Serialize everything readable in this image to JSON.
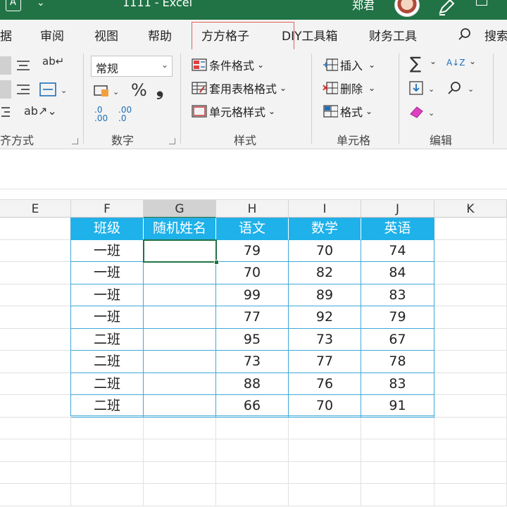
{
  "window": {
    "title_partial": "1111  -  Excel",
    "user_name_partial": "郑君"
  },
  "tabs": [
    {
      "label": "据",
      "id": "data"
    },
    {
      "label": "审阅",
      "id": "review"
    },
    {
      "label": "视图",
      "id": "view"
    },
    {
      "label": "帮助",
      "id": "help"
    },
    {
      "label": "方方格子",
      "id": "fangfang"
    },
    {
      "label": "DIY工具箱",
      "id": "diy"
    },
    {
      "label": "财务工具",
      "id": "finance"
    },
    {
      "label": "搜索",
      "id": "search"
    }
  ],
  "ribbon": {
    "alignment": {
      "label": "齐方式"
    },
    "number": {
      "label": "数字",
      "format_value": "常规",
      "percent_glyph": "%",
      "comma_glyph": "❟",
      "inc_decimal": ".0 .00",
      "dec_decimal": ".00 .0"
    },
    "styles": {
      "label": "样式",
      "conditional_format": "条件格式",
      "format_as_table": "套用表格格式",
      "cell_styles": "单元格样式"
    },
    "cells": {
      "label": "单元格",
      "insert": "插入",
      "delete": "删除",
      "format": "格式"
    },
    "editing": {
      "label": "编辑",
      "sum_glyph": "∑",
      "sort_glyph": "A↓Z"
    }
  },
  "columns": [
    "E",
    "F",
    "G",
    "H",
    "I",
    "J",
    "K"
  ],
  "table": {
    "headers": [
      "班级",
      "随机姓名",
      "语文",
      "数学",
      "英语"
    ],
    "rows": [
      [
        "一班",
        "",
        "79",
        "70",
        "74"
      ],
      [
        "一班",
        "",
        "70",
        "82",
        "84"
      ],
      [
        "一班",
        "",
        "99",
        "89",
        "83"
      ],
      [
        "一班",
        "",
        "77",
        "92",
        "79"
      ],
      [
        "二班",
        "",
        "95",
        "73",
        "67"
      ],
      [
        "二班",
        "",
        "73",
        "77",
        "78"
      ],
      [
        "二班",
        "",
        "88",
        "76",
        "83"
      ],
      [
        "二班",
        "",
        "66",
        "70",
        "91"
      ]
    ]
  },
  "active_cell": "G2",
  "colors": {
    "title_bar": "#217346",
    "table_header": "#1eb1ea",
    "table_border": "#3fa9d8",
    "highlight_box": "#e06060"
  }
}
